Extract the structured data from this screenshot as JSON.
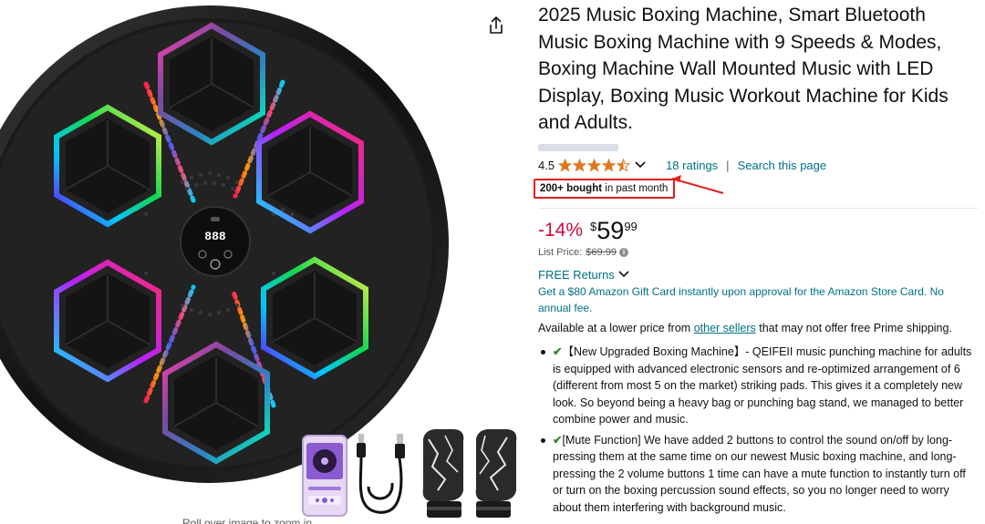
{
  "product": {
    "title": "2025 Music Boxing Machine, Smart Bluetooth Music Boxing Machine with 9 Speeds & Modes, Boxing Machine Wall Mounted Music with LED Display, Boxing Music Workout Machine for Kids and Adults.",
    "display_digits": "888",
    "rating_value": "4.5",
    "rating_stars": 4.5,
    "ratings_count": "18 ratings",
    "search_page": "Search this page",
    "separator": "|",
    "bought_bold": "200+ bought",
    "bought_rest": " in past month",
    "discount": "-14%",
    "currency": "$",
    "price_whole": "59",
    "price_fraction": "99",
    "list_price_label": "List Price:",
    "list_price_value": "$69.99",
    "info_symbol": "i",
    "returns_label": "FREE Returns",
    "gift_card": "Get a $80 Amazon Gift Card instantly upon approval for the Amazon Store Card. No annual fee.",
    "avail_prefix": "Available at a lower price from ",
    "avail_link": "other sellers",
    "avail_suffix": " that may not offer free Prime shipping.",
    "bullet1": "【New Upgraded Boxing Machine】- QEIFEII music punching machine for adults is equipped with advanced electronic sensors and re-optimized arrangement of 6 (different from most 5 on the market) striking pads. This gives it a completely new look. So beyond being a heavy bag or punching bag stand, we managed to better combine power and music.",
    "bullet2": "[Mute Function] We have added 2 buttons to control the sound on/off by long-pressing them at the same time on our newest Music boxing machine, and long-pressing the 2 volume buttons 1 time can have a mute function to instantly turn off or turn on the boxing percussion sound effects, so you no longer need to worry about them interfering with background music.",
    "check_symbol": "✔",
    "image_caption": "Roll over image to zoom in"
  },
  "colors": {
    "star": "#de7921",
    "link": "#007185",
    "discount": "#cc0c39",
    "highlight_box": "#e0201d"
  }
}
